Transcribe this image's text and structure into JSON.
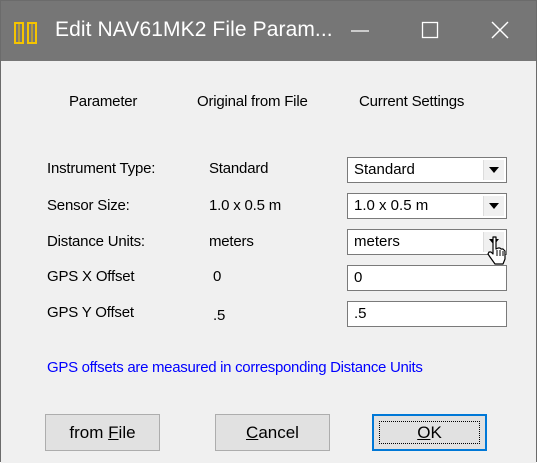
{
  "window": {
    "title": "Edit NAV61MK2 File Param...",
    "icon": "app-icon",
    "controls": {
      "minimize": "minimize-icon",
      "maximize": "maximize-icon",
      "close": "close-icon"
    }
  },
  "headers": {
    "parameter": "Parameter",
    "original": "Original from File",
    "current": "Current Settings"
  },
  "rows": [
    {
      "label": "Instrument Type:",
      "original": "Standard",
      "current": "Standard",
      "control": "dropdown"
    },
    {
      "label": "Sensor Size:",
      "original": "1.0 x 0.5 m",
      "current": "1.0 x 0.5 m",
      "control": "dropdown"
    },
    {
      "label": "Distance Units:",
      "original": "meters",
      "current": "meters",
      "control": "dropdown"
    },
    {
      "label": "GPS X Offset",
      "original": "0",
      "current": "0",
      "control": "text"
    },
    {
      "label": "GPS Y Offset",
      "original": ".5",
      "current": ".5",
      "control": "text"
    }
  ],
  "note": "GPS offsets are measured in corresponding Distance Units",
  "buttons": {
    "from_file_prefix": "from ",
    "from_file_mnemonic": "F",
    "from_file_rest": "ile",
    "cancel_mnemonic": "C",
    "cancel_rest": "ancel",
    "ok_mnemonic": "O",
    "ok_rest": "K"
  },
  "colors": {
    "titlebar": "#767676",
    "note": "#0000ff",
    "focus": "#0078d7"
  }
}
